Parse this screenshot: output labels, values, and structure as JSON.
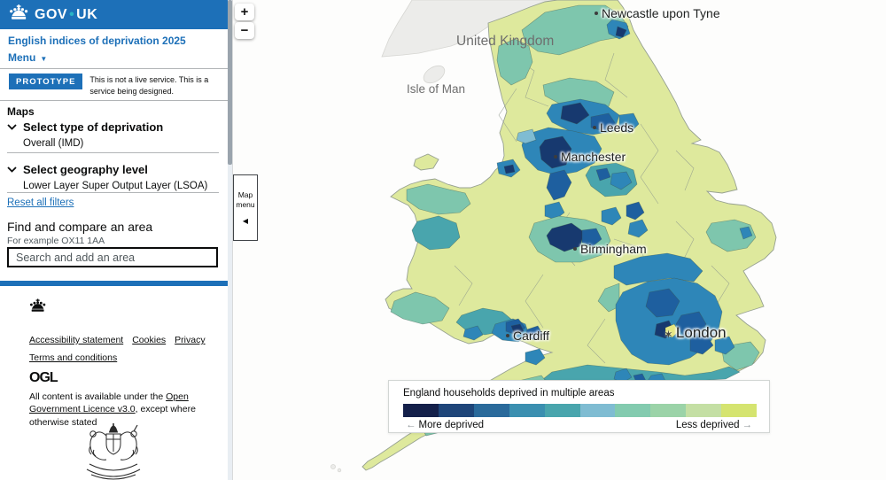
{
  "theme": {
    "accent": "#1d70b8",
    "logo_dot_color": "#29b4c6"
  },
  "header": {
    "logo_left": "GOV",
    "logo_dot": "•",
    "logo_right": "UK"
  },
  "sidebar": {
    "service_name": "English indices of deprivation 2025",
    "menu_label": "Menu",
    "prototype": {
      "badge": "PROTOTYPE",
      "text": "This is not a live service. This is a service being designed."
    },
    "maps_heading": "Maps",
    "filters": [
      {
        "title": "Select type of deprivation",
        "value": "Overall (IMD)"
      },
      {
        "title": "Select geography level",
        "value": "Lower Layer Super Output Layer (LSOA)"
      }
    ],
    "reset_link": "Reset all filters",
    "search": {
      "heading": "Find and compare an area",
      "hint": "For example OX11 1AA",
      "placeholder": "Search and add an area"
    },
    "footer": {
      "links": [
        "Accessibility statement",
        "Cookies",
        "Privacy",
        "Terms and conditions"
      ],
      "ogl_logo": "OGL",
      "license_pre": "All content is available under the ",
      "license_link": "Open Government Licence v3.0",
      "license_post": ", except where otherwise stated"
    }
  },
  "map": {
    "cities": [
      {
        "name": "Newcastle upon Tyne",
        "marker": "dot"
      },
      {
        "name": "United Kingdom",
        "marker": "none"
      },
      {
        "name": "Isle of Man",
        "marker": "none"
      },
      {
        "name": "Leeds",
        "marker": "dot"
      },
      {
        "name": "Manchester",
        "marker": "dot"
      },
      {
        "name": "Birmingham",
        "marker": "dot"
      },
      {
        "name": "Cardiff",
        "marker": "dot"
      },
      {
        "name": "London",
        "marker": "star"
      }
    ]
  },
  "controls": {
    "zoom_in": "+",
    "zoom_out": "−",
    "map_menu": "Map menu"
  },
  "icons": {
    "menu_caret": "▼",
    "map_menu_collapse": "◀",
    "london_star": "✶"
  },
  "legend": {
    "title": "England households deprived in multiple areas",
    "more_label": "More deprived",
    "less_label": "Less deprived",
    "left_arrow": "←",
    "right_arrow": "→",
    "colors": [
      "#14204a",
      "#1e4579",
      "#2a6a9b",
      "#3b8fb0",
      "#49a5ad",
      "#7fbcd2",
      "#83cbaf",
      "#9bd3a8",
      "#c4dfa4",
      "#d5e470"
    ]
  }
}
